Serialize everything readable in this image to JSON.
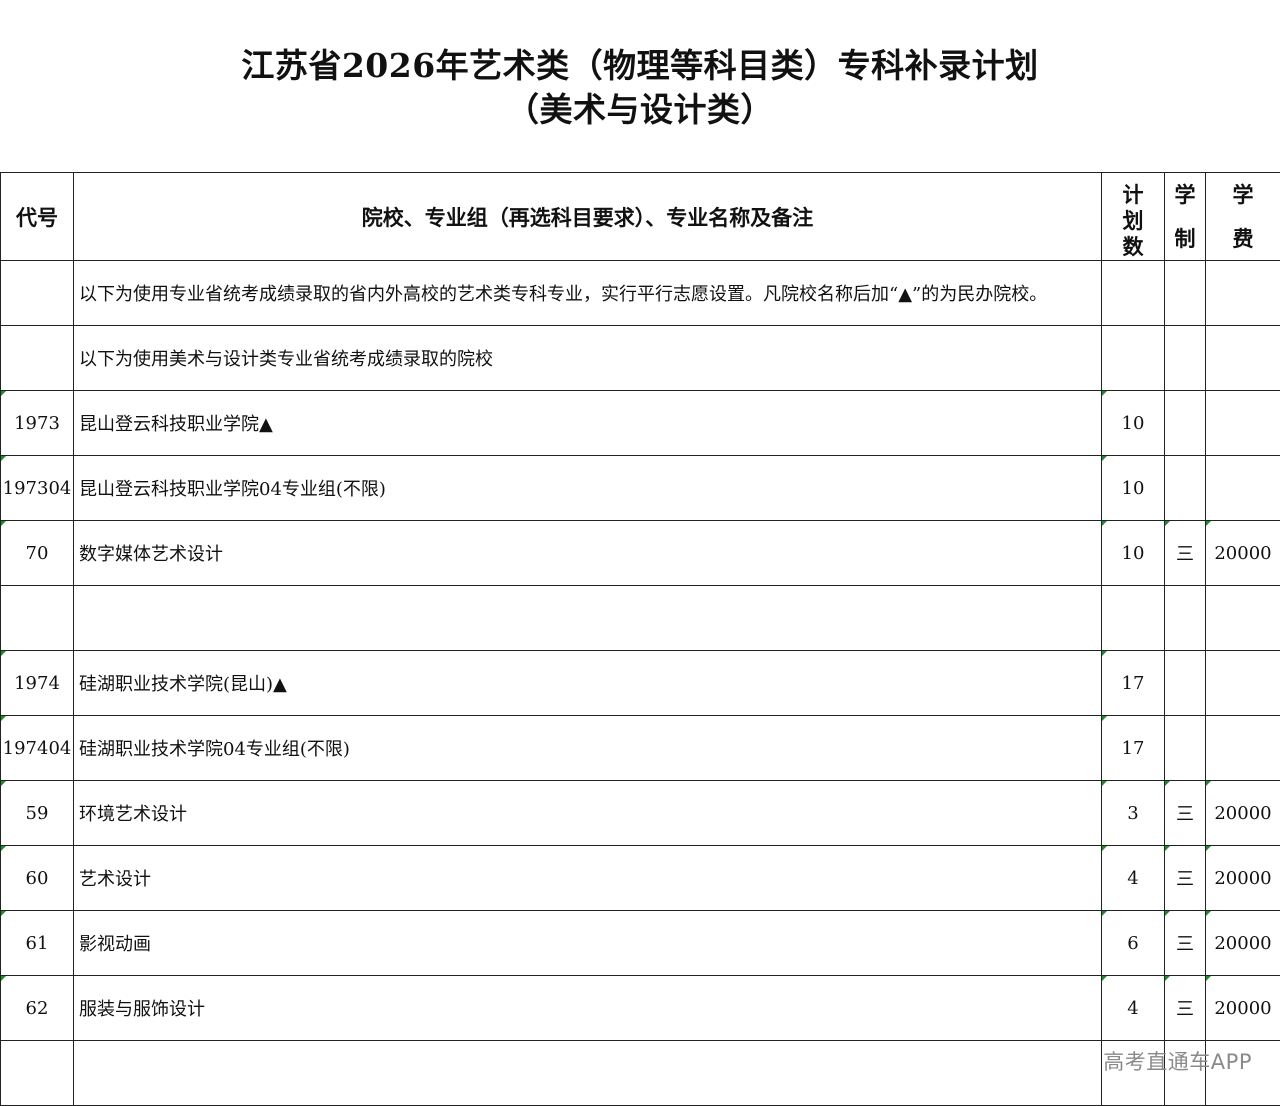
{
  "title": {
    "line1": "江苏省2026年艺术类（物理等科目类）专科补录计划",
    "line2": "（美术与设计类）"
  },
  "header": {
    "code": "代号",
    "name": "院校、专业组（再选科目要求）、专业名称及备注",
    "plan": [
      "计",
      "划",
      "数"
    ],
    "years": [
      "学",
      "制"
    ],
    "fee": [
      "学",
      "费"
    ]
  },
  "rows": [
    {
      "code": "",
      "name": "以下为使用专业省统考成绩录取的省内外高校的艺术类专科专业，实行平行志愿设置。凡院校名称后加“▲”的为民办院校。",
      "plan": "",
      "years": "",
      "fee": ""
    },
    {
      "code": "",
      "name": "以下为使用美术与设计类专业省统考成绩录取的院校",
      "plan": "",
      "years": "",
      "fee": ""
    },
    {
      "code": "1973",
      "name": "昆山登云科技职业学院▲",
      "plan": "10",
      "years": "",
      "fee": ""
    },
    {
      "code": "197304",
      "name": "昆山登云科技职业学院04专业组(不限)",
      "plan": "10",
      "years": "",
      "fee": ""
    },
    {
      "code": "70",
      "name": "数字媒体艺术设计",
      "plan": "10",
      "years": "三",
      "fee": "20000"
    },
    {
      "code": "",
      "name": "",
      "plan": "",
      "years": "",
      "fee": ""
    },
    {
      "code": "1974",
      "name": "硅湖职业技术学院(昆山)▲",
      "plan": "17",
      "years": "",
      "fee": ""
    },
    {
      "code": "197404",
      "name": "硅湖职业技术学院04专业组(不限)",
      "plan": "17",
      "years": "",
      "fee": ""
    },
    {
      "code": "59",
      "name": "环境艺术设计",
      "plan": "3",
      "years": "三",
      "fee": "20000"
    },
    {
      "code": "60",
      "name": "艺术设计",
      "plan": "4",
      "years": "三",
      "fee": "20000"
    },
    {
      "code": "61",
      "name": "影视动画",
      "plan": "6",
      "years": "三",
      "fee": "20000"
    },
    {
      "code": "62",
      "name": "服装与服饰设计",
      "plan": "4",
      "years": "三",
      "fee": "20000"
    },
    {
      "code": "",
      "name": "",
      "plan": "",
      "years": "",
      "fee": ""
    }
  ],
  "watermark": "高考直通车APP"
}
